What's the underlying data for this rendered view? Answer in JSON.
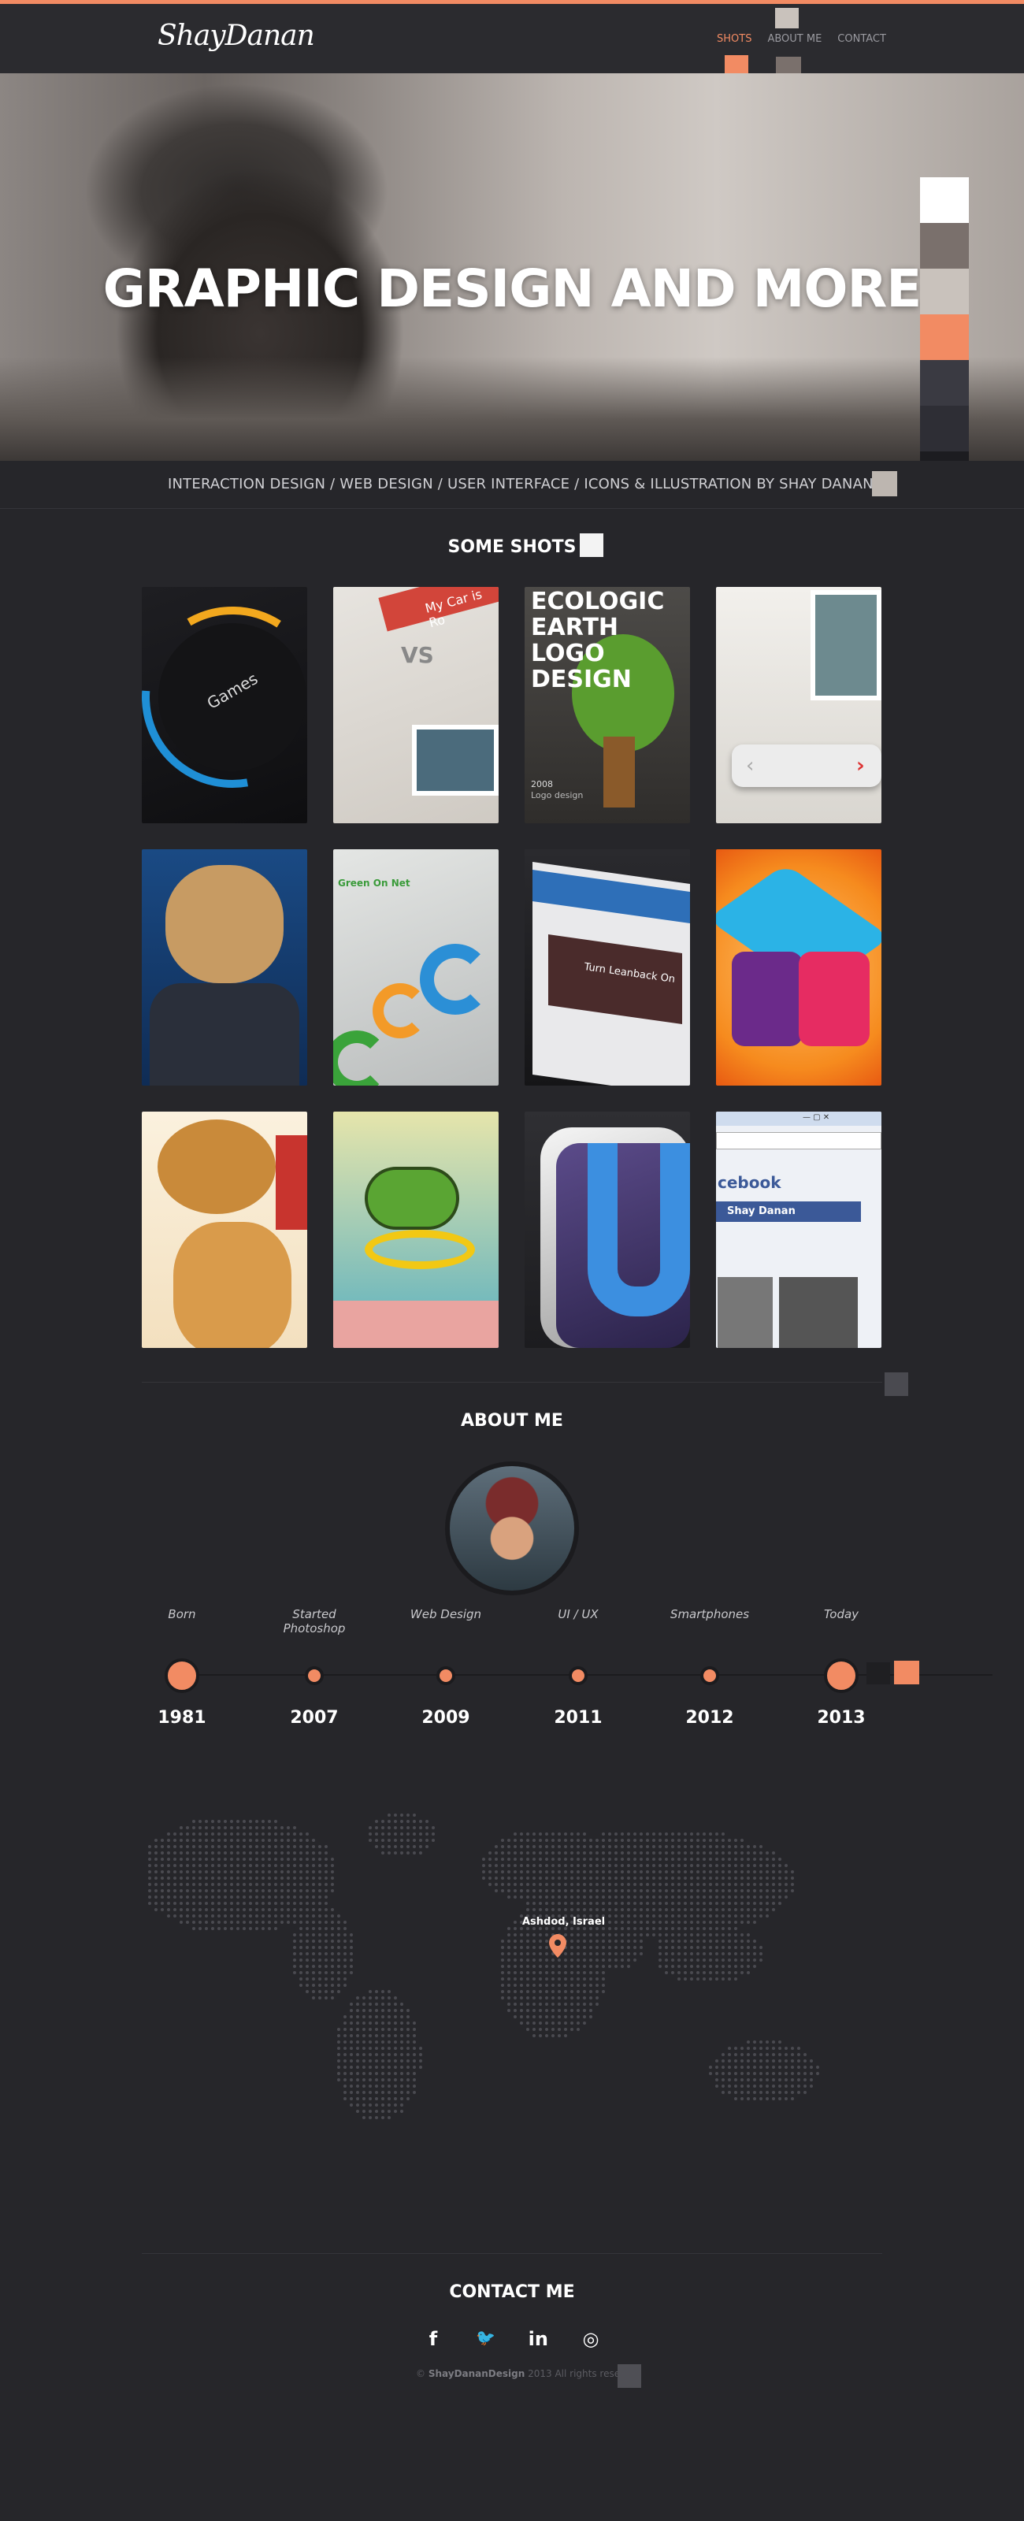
{
  "header": {
    "logo": "ShayDanan",
    "nav": [
      {
        "label": "SHOTS",
        "active": true
      },
      {
        "label": "ABOUT ME",
        "active": false
      },
      {
        "label": "CONTACT",
        "active": false
      }
    ]
  },
  "hero": {
    "title": "GRAPHIC DESIGN AND MORE",
    "palette": [
      "#ffffff",
      "#7a706c",
      "#c9c2bc",
      "#f28b63",
      "#3a3a42",
      "#2e2e35",
      "#1c1c20"
    ]
  },
  "tagline": "INTERACTION DESIGN / WEB DESIGN / USER INTERFACE / ICONS & ILLUSTRATION BY SHAY DANAN",
  "shots": {
    "title": "SOME SHOTS",
    "items": [
      {
        "name": "games-dial",
        "text": "Games"
      },
      {
        "name": "my-car-is-vs",
        "text": "My Car is Ro"
      },
      {
        "name": "ecologic-earth-logo",
        "text": "ECOLOGIC EARTH LOGO DESIGN",
        "year": "2008",
        "sub": "Logo design"
      },
      {
        "name": "car-widget",
        "text": ""
      },
      {
        "name": "bull-character",
        "text": ""
      },
      {
        "name": "green-on-net-cards",
        "text": "Green On Net"
      },
      {
        "name": "leanback-phone",
        "text": "Turn Leanback On"
      },
      {
        "name": "cube-icon",
        "text": ""
      },
      {
        "name": "camel-character",
        "text": ""
      },
      {
        "name": "snorkel-frog",
        "text": ""
      },
      {
        "name": "u-icon",
        "text": ""
      },
      {
        "name": "facebook-chat",
        "text": "Shay Danan"
      }
    ]
  },
  "about": {
    "title": "ABOUT ME",
    "timeline": [
      {
        "label": "Born",
        "year": "1981"
      },
      {
        "label": "Started Photoshop",
        "year": "2007"
      },
      {
        "label": "Web Design",
        "year": "2009"
      },
      {
        "label": "UI / UX",
        "year": "2011"
      },
      {
        "label": "Smartphones",
        "year": "2012"
      },
      {
        "label": "Today",
        "year": "2013"
      }
    ],
    "location": "Ashdod, Israel"
  },
  "contact": {
    "title": "CONTACT ME",
    "social": [
      {
        "icon": "facebook-icon",
        "glyph": "f"
      },
      {
        "icon": "twitter-icon",
        "glyph": "🐦"
      },
      {
        "icon": "linkedin-icon",
        "glyph": "in"
      },
      {
        "icon": "dribbble-icon",
        "glyph": "◎"
      }
    ],
    "copyright_prefix": "© ",
    "copyright_brand": "ShayDananDesign",
    "copyright_suffix": " 2013 All rights reserved"
  },
  "colors": {
    "accent": "#f28b63",
    "background": "#26262a",
    "header": "#2b2b2f"
  }
}
